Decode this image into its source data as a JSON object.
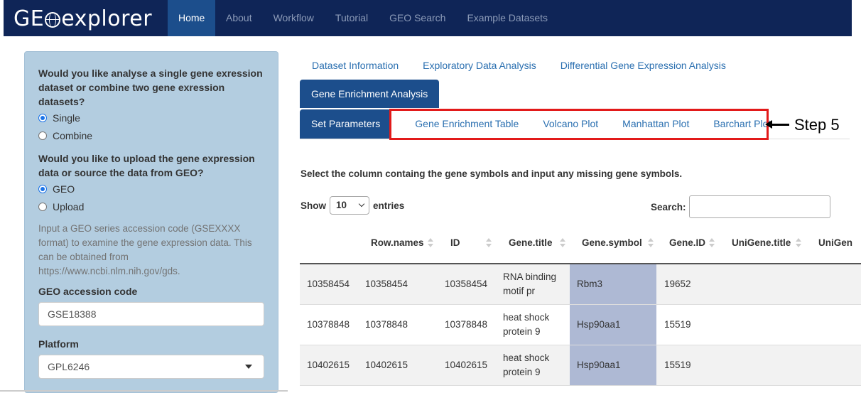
{
  "navbar": {
    "brand_prefix": "GE",
    "brand_suffix": "explorer",
    "items": [
      "Home",
      "About",
      "Workflow",
      "Tutorial",
      "GEO Search",
      "Example Datasets"
    ]
  },
  "sidebar": {
    "q1": "Would you like analyse a single gene exression dataset or combine two gene exression datasets?",
    "opt_single": "Single",
    "opt_combine": "Combine",
    "q2": "Would you like to upload the gene expression data or source the data from GEO?",
    "opt_geo": "GEO",
    "opt_upload": "Upload",
    "help": "Input a GEO series accession code (GSEXXXX format) to examine the gene expression data. This can be obtained from https://www.ncbi.nlm.nih.gov/gds.",
    "accession_label": "GEO accession code",
    "accession_value": "GSE18388",
    "platform_label": "Platform",
    "platform_value": "GPL6246"
  },
  "tabs_top": [
    "Dataset Information",
    "Exploratory Data Analysis",
    "Differential Gene Expression Analysis"
  ],
  "tab_active": "Gene Enrichment Analysis",
  "subtabs": [
    "Set Parameters",
    "Gene Enrichment Table",
    "Volcano Plot",
    "Manhattan Plot",
    "Barchart Plot"
  ],
  "annotation": "Step 5",
  "instruction": "Select the column containg the gene symbols and input any missing gene symbols.",
  "show_label": "Show",
  "entries_value": "10",
  "entries_label": "entries",
  "search_label": "Search:",
  "columns": [
    "Row.names",
    "ID",
    "Gene.title",
    "Gene.symbol",
    "Gene.ID",
    "UniGene.title",
    "UniGen"
  ],
  "rows": [
    {
      "rowid": "10358454",
      "rownames": "10358454",
      "id": "10358454",
      "title1": "RNA binding",
      "title2": "motif pr",
      "symbol": "Rbm3",
      "geneid": "19652"
    },
    {
      "rowid": "10378848",
      "rownames": "10378848",
      "id": "10378848",
      "title1": "heat shock",
      "title2": "protein 9",
      "symbol": "Hsp90aa1",
      "geneid": "15519"
    },
    {
      "rowid": "10402615",
      "rownames": "10402615",
      "id": "10402615",
      "title1": "heat shock",
      "title2": "protein 9",
      "symbol": "Hsp90aa1",
      "geneid": "15519"
    }
  ],
  "colors": {
    "navbar": "#0f2557",
    "active": "#1c4e8c",
    "sidebar": "#b3cde0",
    "highlight": "#e21a1a",
    "symbol_column": "#aeb9d4"
  }
}
